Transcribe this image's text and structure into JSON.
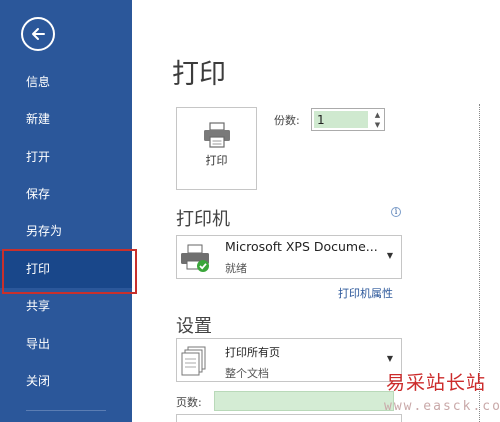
{
  "sidebar": {
    "items": [
      {
        "label": "信息"
      },
      {
        "label": "新建"
      },
      {
        "label": "打开"
      },
      {
        "label": "保存"
      },
      {
        "label": "另存为"
      },
      {
        "label": "打印",
        "active": true
      },
      {
        "label": "共享"
      },
      {
        "label": "导出"
      },
      {
        "label": "关闭"
      }
    ],
    "background": "#2b579a",
    "active_background": "#19478a",
    "highlight_color": "#c8302c"
  },
  "main": {
    "title": "打印",
    "print_button": {
      "label": "打印",
      "icon": "printer-icon"
    },
    "copies": {
      "label": "份数:",
      "value": "1"
    },
    "printer_section": {
      "title": "打印机",
      "selected_printer": "Microsoft XPS Docume...",
      "status": "就绪",
      "properties_link": "打印机属性"
    },
    "settings_section": {
      "title": "设置",
      "range_title": "打印所有页",
      "range_subtitle": "整个文档",
      "pages_label": "页数:",
      "pages_value": ""
    }
  },
  "watermark": {
    "text": "易采站长站",
    "url": "www.easck.com"
  }
}
